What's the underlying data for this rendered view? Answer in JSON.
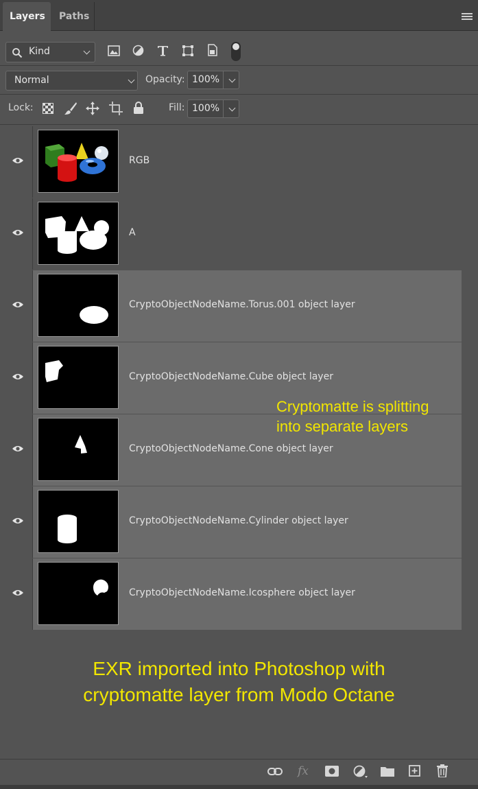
{
  "tabs": [
    {
      "label": "Layers"
    },
    {
      "label": "Paths"
    }
  ],
  "filter": {
    "kind_label": "Kind"
  },
  "blend": {
    "mode": "Normal",
    "opacity_label": "Opacity:",
    "opacity_value": "100%"
  },
  "lock": {
    "label": "Lock:",
    "fill_label": "Fill:",
    "fill_value": "100%"
  },
  "layers": [
    {
      "name": "RGB",
      "visible": true,
      "highlighted": false
    },
    {
      "name": "A",
      "visible": true,
      "highlighted": false
    },
    {
      "name": "CryptoObjectNodeName.Torus.001 object layer",
      "visible": true,
      "highlighted": true
    },
    {
      "name": "CryptoObjectNodeName.Cube object layer",
      "visible": true,
      "highlighted": true
    },
    {
      "name": "CryptoObjectNodeName.Cone object layer",
      "visible": true,
      "highlighted": true
    },
    {
      "name": "CryptoObjectNodeName.Cylinder object layer",
      "visible": true,
      "highlighted": true
    },
    {
      "name": "CryptoObjectNodeName.Icosphere object layer",
      "visible": true,
      "highlighted": true
    }
  ],
  "annotations": {
    "split_line1": "Cryptomatte is splitting",
    "split_line2": "into separate layers",
    "exr_line1": "EXR imported into Photoshop with",
    "exr_line2": "cryptomatte layer from Modo Octane"
  },
  "bottom_toolbar": {
    "fx_label": "fx"
  },
  "colors": {
    "annotation": "#f2e600",
    "panel_bg": "#535353",
    "highlight_row": "#6b6b6b"
  }
}
